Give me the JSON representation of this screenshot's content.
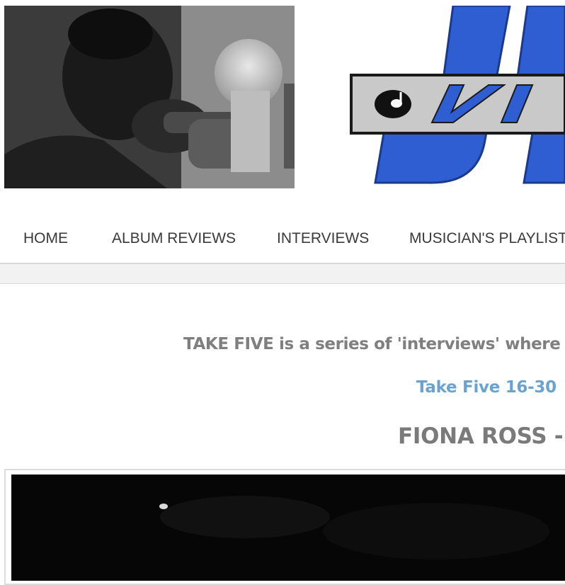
{
  "header": {
    "photo_icon": "trumpet-player-photo",
    "logo_icon": "jazz-views-logo"
  },
  "nav": {
    "items": [
      {
        "label": "HOME"
      },
      {
        "label": "ALBUM REVIEWS"
      },
      {
        "label": "INTERVIEWS"
      },
      {
        "label": "MUSICIAN'S PLAYLIST"
      }
    ]
  },
  "content": {
    "intro": "TAKE FIVE is a series of 'interviews' where",
    "link": "Take Five 16-30",
    "title": "FIONA ROSS -"
  },
  "colors": {
    "link": "#6aa3d0",
    "logo_blue": "#2f5ed3",
    "text_gray": "#7f7f7f"
  }
}
